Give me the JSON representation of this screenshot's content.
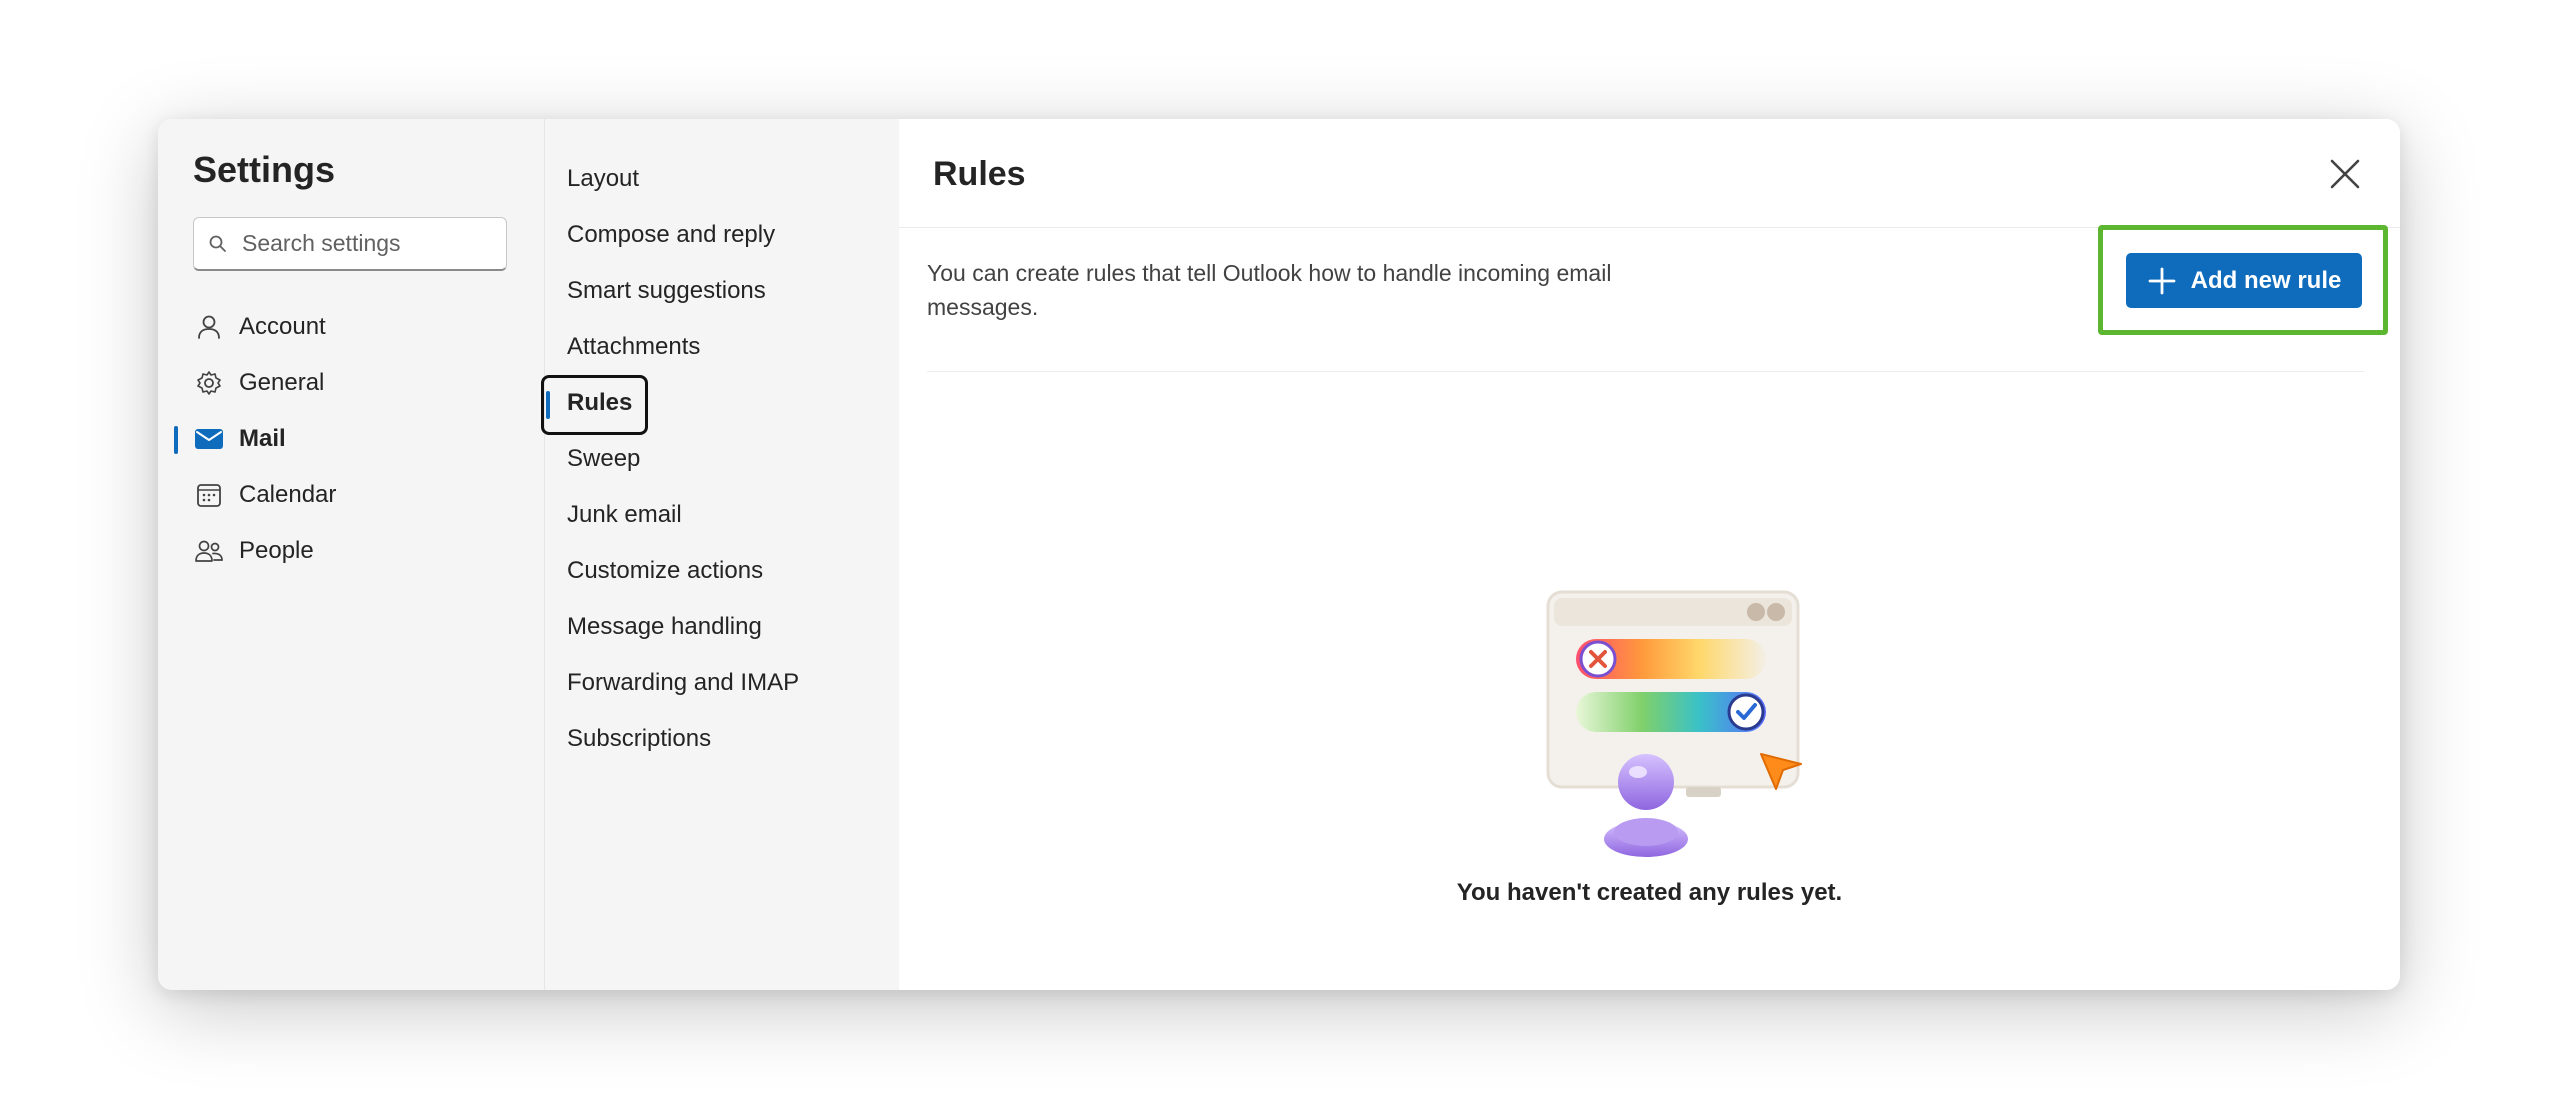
{
  "sidebar": {
    "title": "Settings",
    "search_placeholder": "Search settings",
    "items": [
      {
        "label": "Account",
        "icon": "person-icon"
      },
      {
        "label": "General",
        "icon": "gear-icon"
      },
      {
        "label": "Mail",
        "icon": "mail-icon",
        "active": true
      },
      {
        "label": "Calendar",
        "icon": "calendar-icon"
      },
      {
        "label": "People",
        "icon": "people-icon"
      }
    ]
  },
  "submenu": {
    "items": [
      {
        "label": "Layout"
      },
      {
        "label": "Compose and reply"
      },
      {
        "label": "Smart suggestions"
      },
      {
        "label": "Attachments"
      },
      {
        "label": "Rules",
        "active": true
      },
      {
        "label": "Sweep"
      },
      {
        "label": "Junk email"
      },
      {
        "label": "Customize actions"
      },
      {
        "label": "Message handling"
      },
      {
        "label": "Forwarding and IMAP"
      },
      {
        "label": "Subscriptions"
      }
    ]
  },
  "main": {
    "title": "Rules",
    "description": "You can create rules that tell Outlook how to handle incoming email messages.",
    "add_button_label": "Add new rule",
    "empty_state_text": "You haven't created any rules yet."
  },
  "colors": {
    "accent": "#0f6cbd",
    "highlight_border": "#5cb630",
    "pane_background": "#f5f5f5"
  }
}
